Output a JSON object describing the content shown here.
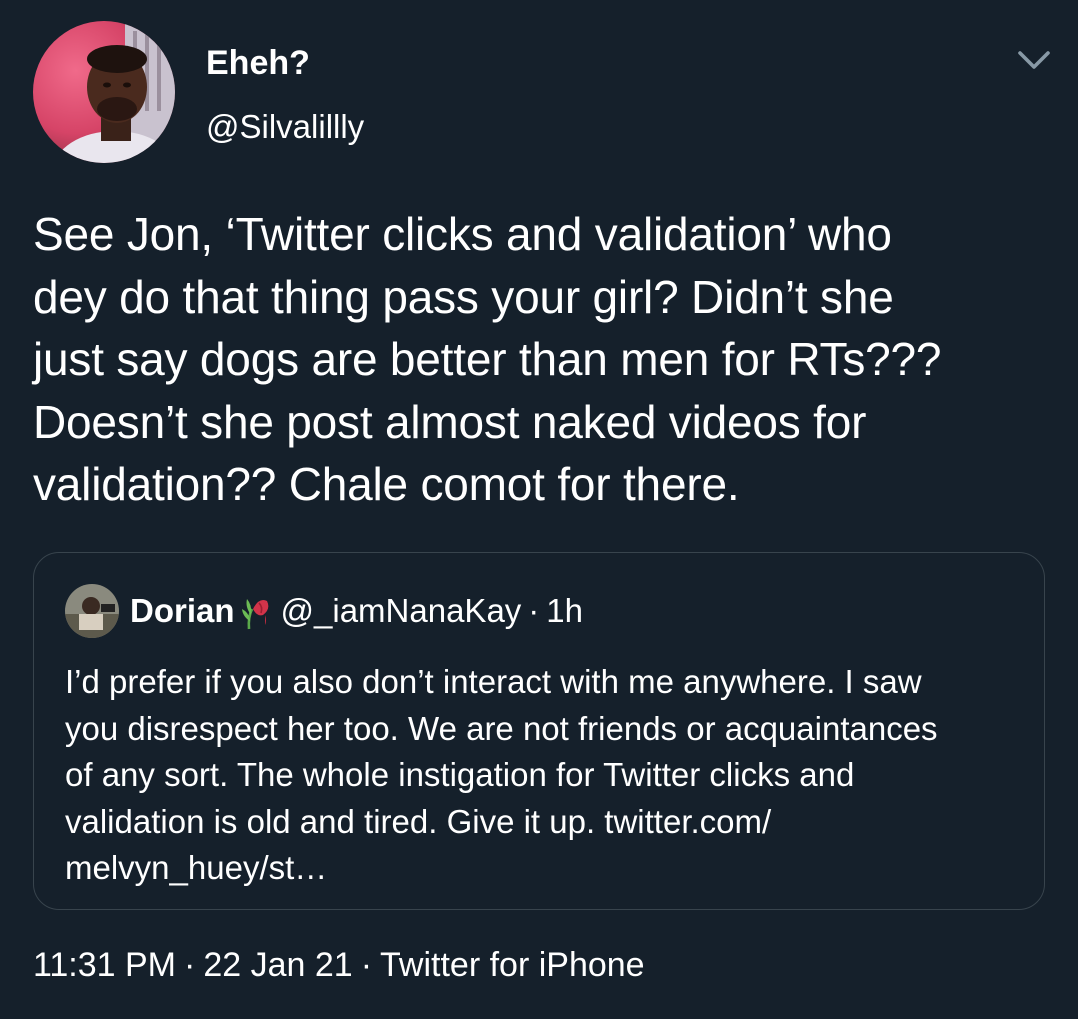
{
  "author": {
    "display_name": "Eheh?",
    "handle": "@Silvalillly",
    "avatar_icon": "profile-photo"
  },
  "menu": {
    "icon": "chevron-down-icon"
  },
  "tweet": {
    "text_lines": [
      "See Jon, ‘Twitter clicks and validation’ who",
      "dey do that thing pass your girl? Didn’t she",
      "just say dogs are better than men for RTs???",
      "Doesn’t she post almost naked videos for",
      "validation?? Chale comot for there."
    ]
  },
  "quoted_tweet": {
    "display_name": "Dorian",
    "name_emoji": "wilted-flower-icon",
    "handle": "@_iamNanaKay",
    "separator": "·",
    "time": "1h",
    "text_lines": [
      "I’d prefer if you also don’t interact with me anywhere. I saw",
      "you disrespect her too. We are not friends or acquaintances",
      "of any sort. The whole instigation for Twitter clicks and",
      "validation is old and tired. Give it up. twitter.com/",
      "melvyn_huey/st…"
    ]
  },
  "meta": {
    "time": "11:31 PM",
    "separator": "·",
    "date": "22 Jan 21",
    "source": "Twitter for iPhone"
  },
  "colors": {
    "background": "#15202b",
    "border": "#38444d",
    "text": "#ffffff",
    "caret": "#8899a6"
  }
}
